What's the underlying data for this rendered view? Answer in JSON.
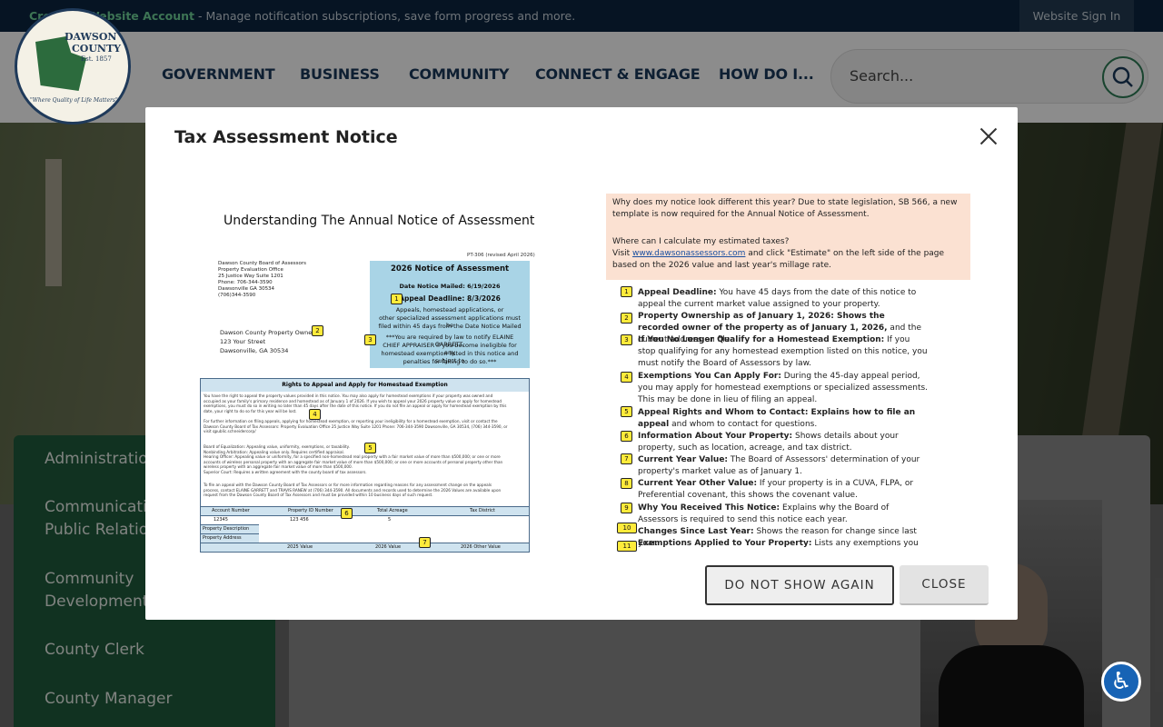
{
  "topbar": {
    "create_account_link": "Create a Website Account",
    "message": " - Manage notification subscriptions, save form progress and more.",
    "sign_in": "Website Sign In"
  },
  "logo": {
    "line1": "DAWSON",
    "line2": "COUNTY",
    "established": "Est. 1857",
    "motto": "\"Where Quality of Life Matters\""
  },
  "nav": [
    "GOVERNMENT",
    "BUSINESS",
    "COMMUNITY",
    "CONNECT & ENGAGE",
    "HOW DO I..."
  ],
  "search": {
    "placeholder": "Search..."
  },
  "sidebar": [
    "Administration",
    "Communications & Public Relations",
    "Community Development",
    "County Clerk",
    "County Manager"
  ],
  "modal": {
    "title": "Tax Assessment Notice",
    "do_not_show_label": "DO NOT SHOW AGAIN",
    "close_label": "CLOSE"
  },
  "notice": {
    "heading": "Understanding The Annual Notice of Assessment",
    "form_id": "PT-306 (revised April 2026)",
    "office_address": [
      "Dawson County Board of Assessors",
      "Property Evaluation Office",
      "25 Justice Way Suite 1201",
      "Phone: 706-344-3590",
      "Dawsonville GA 30534",
      "(706)344-3590"
    ],
    "blue_title": "2026 Notice of Assessment",
    "date_mailed": "Date Notice Mailed: 6/19/2026",
    "appeal_deadline": "Appeal Deadline: 8/3/2026",
    "blue_text1": "Appeals, homestead applications, or",
    "blue_text2": "other specialized assessment applications must be",
    "blue_text3": "filed within 45 days from the Date Notice Mailed",
    "blue_text4": "***You are required by law to notify ELAINE GARRETT,",
    "blue_text5": "CHIEF APPRAISER if you become ineligible for any",
    "blue_text6": "homestead exemption listed in this notice and subject to",
    "blue_text7": "penalties for failing to do so.***",
    "owner": [
      "Dawson County Property Owner",
      "123 Your Street",
      "Dawsonville, GA 30534"
    ],
    "rights_title": "Rights to Appeal and Apply for Homestead Exemption",
    "rights_lines": [
      "You have the right to appeal the property values provided in this notice. You may also apply for homestead exemptions if your property was owned and",
      "occupied as your family's primary residence and homestead as of January 1 of 2026. If you wish to appeal your 2026 property value or apply for homestead",
      "exemptions, you must do so in writing no later than 45 days after the date of this notice. If you do not file an appeal or apply for homestead exemption by this",
      "date, your right to do so for this year will be lost.",
      "For further information on filing appeals, applying for homestead exemption, or reporting your ineligibility for a homestead exemption, visit or contact the",
      "Dawson County Board of Tax Assessors: Property Evaluation Office 25 Justice Way Suite 1201 Phone: 706-344-3590 Dawsonville, GA 30534, (706) 344-3590, or",
      "visit qpublic.schneidercorp/",
      "Board of Equalization: Appealing value, uniformity, exemptions, or taxability.",
      "Nonbinding Arbitration: Appealing value only. Requires certified appraisal.",
      "Hearing Officer: Appealing value or uniformity, for a specified non-homestead real property with a fair market value of more than $500,000; or one or more",
      "accounts of wireless personal property with an aggregate fair market value of more than $500,000; or one or more accounts of personal property other than",
      "wireless property with an aggregate fair market value of more than $500,000.",
      "Superior Court: Requires a written agreement with the county board of tax assessors.",
      "To file an appeal with the Dawson County Board of Tax Assessors or for more information regarding reasons for any assessment change on the appeals",
      "process, contact ELAINE GARRETT and TRAVIS RANEW at (706) 344-3590. All documents and records used to determine the 2026 Values are available upon",
      "request from the Dawson County Board of Tax Assessors and must be provided within 10 business days of such request."
    ],
    "table_headers": [
      "Account Number",
      "Property ID Number",
      "Total Acreage",
      "Tax District"
    ],
    "table_values": [
      "12345",
      "123 456",
      "5",
      ""
    ],
    "table_labels": [
      "Property Description",
      "Property Address"
    ],
    "value_headers": [
      "2025 Value",
      "2026 Value",
      "2026 Other Value"
    ],
    "peach_p1": "Why does my notice look different this year? Due to state legislation, SB 566, a new template is now required for the Annual Notice of Assessment.",
    "peach_p2a": "Where can I calculate my estimated taxes?",
    "peach_p2b": "Visit ",
    "peach_link": "www.dawsonassessors.com",
    "peach_p2c": " and click \"Estimate\" on the left side of the page based on the 2026 value and last year's millage rate.",
    "items": [
      {
        "n": "1",
        "b": "Appeal Deadline:",
        "t": " You have 45 days from the date of this notice to appeal the current market value assigned to your property."
      },
      {
        "n": "2",
        "b": "Property Ownership as of January 1, 2026: Shows the recorded owner of the property as of January 1, 2026,",
        "t": " and the current address on file."
      },
      {
        "n": "3",
        "b": "If You No Longer Qualify for a Homestead Exemption:",
        "t": " If you stop qualifying for any homestead exemption listed on this notice, you must notify the Board of Assessors by law."
      },
      {
        "n": "4",
        "b": "Exemptions You Can Apply For:",
        "t": " During the 45-day appeal period, you may apply for homestead exemptions or specialized assessments. This may be done in lieu of filing an appeal."
      },
      {
        "n": "5",
        "b": "Appeal Rights and Whom to Contact: Explains how to file an appeal",
        "t": " and whom to contact for questions."
      },
      {
        "n": "6",
        "b": "Information About Your Property:",
        "t": " Shows details about your property, such as location, acreage, and tax district."
      },
      {
        "n": "7",
        "b": "Current Year Value:",
        "t": " The Board of Assessors' determination of your property's market value as of January 1."
      },
      {
        "n": "8",
        "b": "Current Year Other Value:",
        "t": " If your property is in a CUVA, FLPA, or Preferential covenant, this shows the covenant value."
      },
      {
        "n": "9",
        "b": "Why You Received This Notice:",
        "t": " Explains why the Board of Assessors is required to send this notice each year."
      },
      {
        "n": "10",
        "b": "Changes Since Last Year:",
        "t": " Shows the reason for change since last year."
      },
      {
        "n": "11",
        "b": "Exemptions Applied to Your Property:",
        "t": " Lists any exemptions you"
      }
    ]
  }
}
